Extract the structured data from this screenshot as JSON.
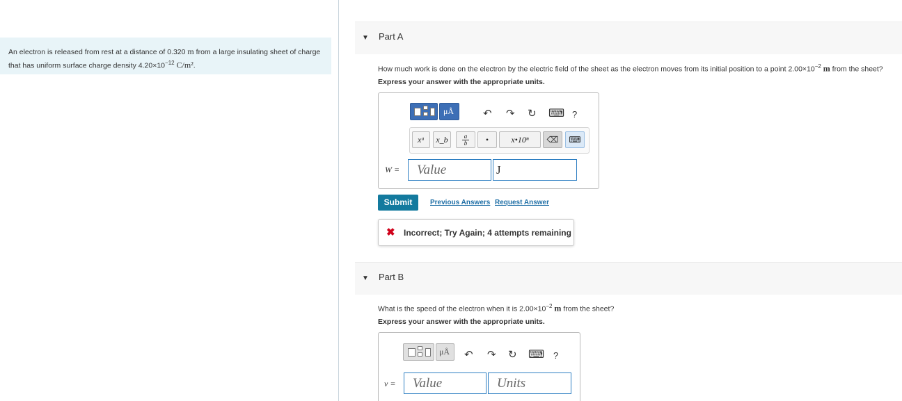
{
  "problem": {
    "text_before": "An electron is released from rest at a distance of 0.320 ",
    "unit_m": "m",
    "text_mid": " from a large insulating sheet of charge that has uniform surface charge density 4.20×10",
    "exp": "−12",
    "unit_density": "C/m²",
    "end": "."
  },
  "part_a": {
    "title": "Part A",
    "question_before": "How much work is done on the electron by the electric field of the sheet as the electron moves from its initial position to a point 2.00×10",
    "question_exp": "−2",
    "question_unit": "m",
    "question_after": " from the sheet?",
    "instruction": "Express your answer with the appropriate units.",
    "toolbar": {
      "mu_label": "μÅ",
      "undo": "↶",
      "redo": "↷",
      "reset": "↻",
      "keyboard": "⌨",
      "help": "?"
    },
    "templates": {
      "superscript": "xᵃ",
      "subscript": "x_b",
      "fraction_top": "a",
      "fraction_bottom": "b",
      "dot": "•",
      "sci": "x•10ⁿ",
      "delete": "⌫",
      "kbd": "⌨"
    },
    "variable": "W =",
    "value_placeholder": "Value",
    "unit_value": "J",
    "submit": "Submit",
    "previous_answers": "Previous Answers",
    "request_answer": "Request Answer",
    "feedback_icon": "✖",
    "feedback": "Incorrect; Try Again; 4 attempts remaining"
  },
  "part_b": {
    "title": "Part B",
    "question_before": "What is the speed of the electron when it is 2.00×10",
    "question_exp": "−2",
    "question_unit": "m",
    "question_after": " from the sheet?",
    "instruction": "Express your answer with the appropriate units.",
    "toolbar": {
      "mu_label": "μÅ",
      "undo": "↶",
      "redo": "↷",
      "reset": "↻",
      "keyboard": "⌨",
      "help": "?"
    },
    "variable": "v =",
    "value_placeholder": "Value",
    "units_placeholder": "Units"
  }
}
